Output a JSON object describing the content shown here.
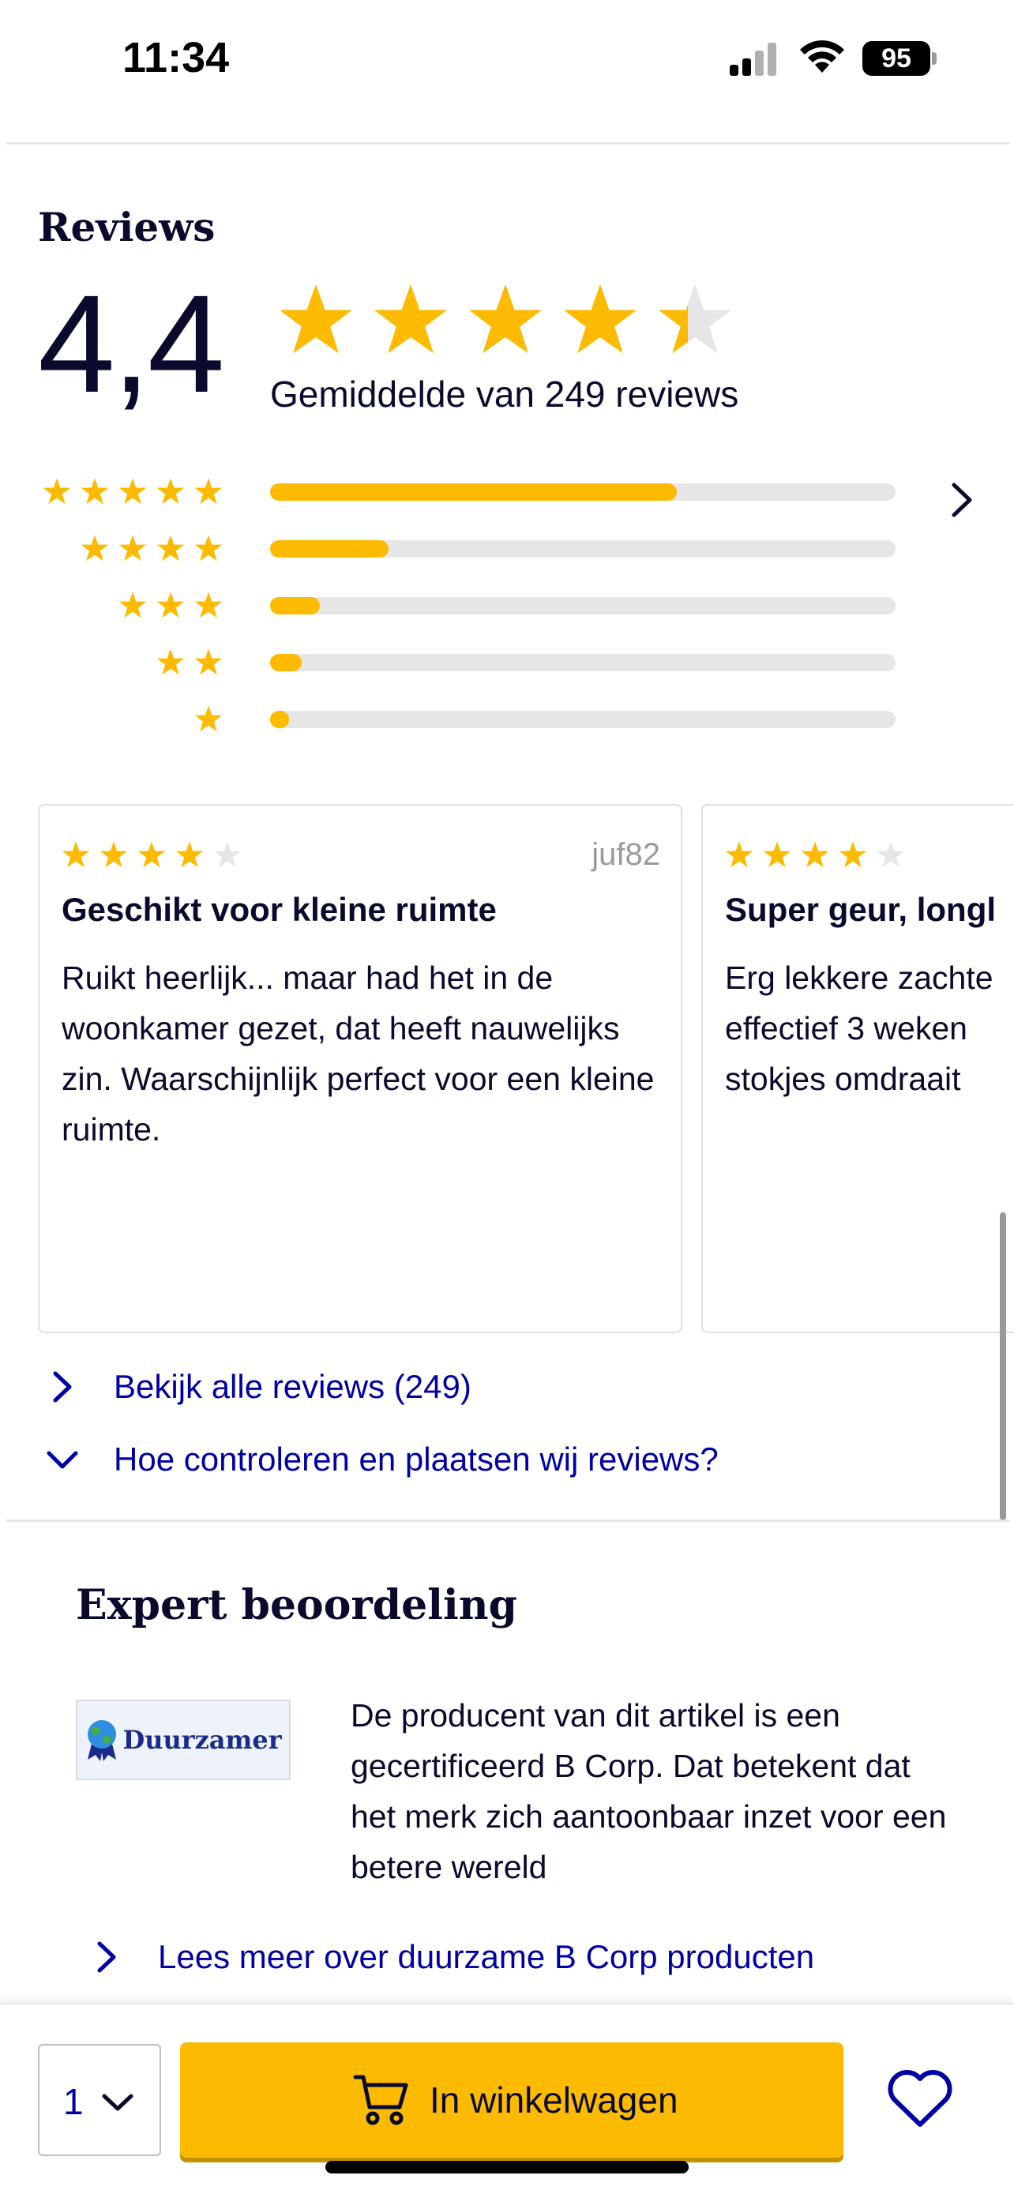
{
  "status_bar": {
    "time": "11:34",
    "battery": "95"
  },
  "reviews": {
    "title": "Reviews",
    "average": "4,4",
    "average_value": 4.4,
    "caption": "Gemiddelde van 249 reviews",
    "distribution": [
      {
        "stars": 5,
        "fraction": 0.65
      },
      {
        "stars": 4,
        "fraction": 0.19
      },
      {
        "stars": 3,
        "fraction": 0.08
      },
      {
        "stars": 2,
        "fraction": 0.05
      },
      {
        "stars": 1,
        "fraction": 0.03
      }
    ],
    "cards": [
      {
        "rating": 4,
        "author": "juf82",
        "title": "Geschikt voor kleine ruimte",
        "body": "Ruikt heerlijk... maar had het in de woonkamer gezet, dat heeft nauwelijks zin. Waarschijnlijk perfect voor een kleine ruimte."
      },
      {
        "rating": 4,
        "author": "",
        "title": "Super geur, longl",
        "body": "Erg lekkere zachte effectief 3 weken stokjes omdraait"
      }
    ],
    "all_reviews_link": "Bekijk alle reviews (249)",
    "how_link": "Hoe controleren en plaatsen wij reviews?"
  },
  "expert": {
    "title": "Expert beoordeling",
    "badge_label": "Duurzamer",
    "text": "De producent van dit artikel is een gecertificeerd B Corp. Dat betekent dat het merk zich aantoonbaar inzet voor een betere wereld",
    "link": "Lees meer over duurzame B Corp producten"
  },
  "bottom_bar": {
    "quantity": "1",
    "cart_label": "In winkelwagen"
  },
  "colors": {
    "star": "#fcbb00",
    "star_empty": "#e6e6e6",
    "link": "#0000a4",
    "text": "#0a0a2d"
  },
  "icons": [
    "star-icon",
    "chevron-right-icon",
    "chevron-down-icon",
    "cart-icon",
    "heart-icon",
    "wifi-icon",
    "signal-icon",
    "battery-icon"
  ]
}
